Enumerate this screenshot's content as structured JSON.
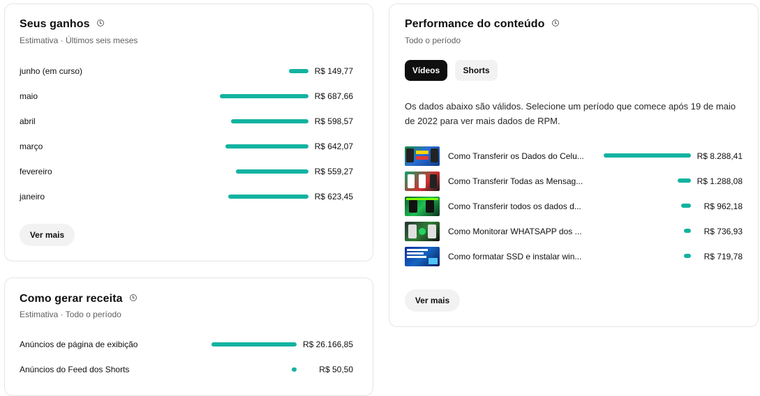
{
  "earnings": {
    "title": "Seus ganhos",
    "subtitle": "Estimativa · Últimos seis meses",
    "rows": [
      {
        "label": "junho (em curso)",
        "value": "R$ 149,77",
        "amount": 149.77
      },
      {
        "label": "maio",
        "value": "R$ 687,66",
        "amount": 687.66
      },
      {
        "label": "abril",
        "value": "R$ 598,57",
        "amount": 598.57
      },
      {
        "label": "março",
        "value": "R$ 642,07",
        "amount": 642.07
      },
      {
        "label": "fevereiro",
        "value": "R$ 559,27",
        "amount": 559.27
      },
      {
        "label": "janeiro",
        "value": "R$ 623,45",
        "amount": 623.45
      }
    ],
    "more_label": "Ver mais"
  },
  "revenue": {
    "title": "Como gerar receita",
    "subtitle": "Estimativa · Todo o período",
    "rows": [
      {
        "label": "Anúncios de página de exibição",
        "value": "R$ 26.166,85",
        "amount": 26166.85
      },
      {
        "label": "Anúncios do Feed dos Shorts",
        "value": "R$ 50,50",
        "amount": 50.5
      }
    ]
  },
  "performance": {
    "title": "Performance do conteúdo",
    "subtitle": "Todo o período",
    "tabs": [
      {
        "label": "Vídeos",
        "active": true
      },
      {
        "label": "Shorts",
        "active": false
      }
    ],
    "note": "Os dados abaixo são válidos. Selecione um período que comece após 19 de maio de 2022 para ver mais dados de RPM.",
    "videos": [
      {
        "title": "Como Transferir os Dados do Celu...",
        "value": "R$ 8.288,41",
        "amount": 8288.41
      },
      {
        "title": "Como Transferir Todas as Mensag...",
        "value": "R$ 1.288,08",
        "amount": 1288.08
      },
      {
        "title": "Como Transferir todos os dados d...",
        "value": "R$ 962,18",
        "amount": 962.18
      },
      {
        "title": "Como Monitorar WHATSAPP dos ...",
        "value": "R$ 736,93",
        "amount": 736.93
      },
      {
        "title": "Como formatar SSD e instalar win...",
        "value": "R$ 719,78",
        "amount": 719.78
      }
    ],
    "more_label": "Ver mais"
  },
  "colors": {
    "accent": "#12b3a0"
  }
}
